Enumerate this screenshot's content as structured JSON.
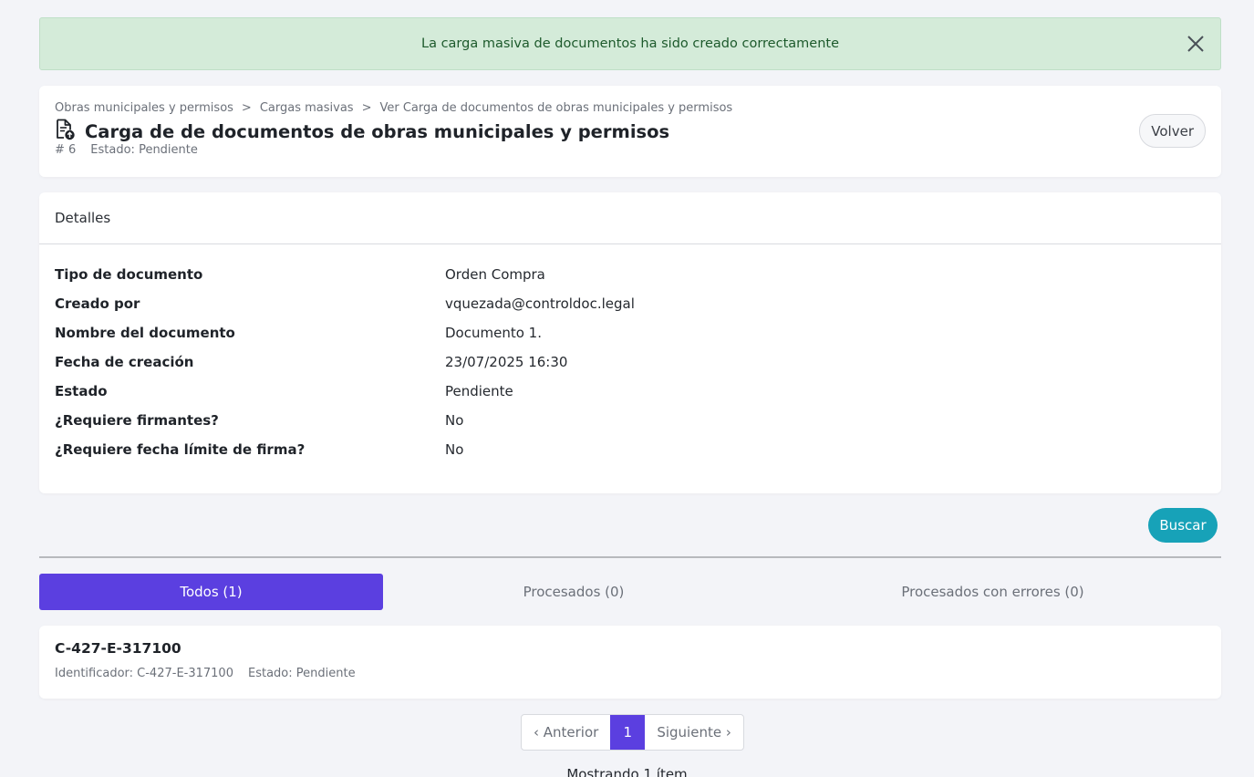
{
  "alert": {
    "message": "La carga masiva de documentos ha sido creado correctamente"
  },
  "header": {
    "breadcrumb": [
      "Obras municipales y permisos",
      ">",
      "Cargas masivas",
      ">",
      "Ver Carga de documentos de obras municipales y permisos"
    ],
    "title": "Carga de de documentos de obras municipales y permisos",
    "id_label": "# 6",
    "status_label": "Estado: Pendiente",
    "back_label": "Volver"
  },
  "details": {
    "heading": "Detalles",
    "rows": [
      {
        "label": "Tipo de documento",
        "value": "Orden Compra"
      },
      {
        "label": "Creado por",
        "value": "vquezada@controldoc.legal"
      },
      {
        "label": "Nombre del documento",
        "value": "Documento 1."
      },
      {
        "label": "Fecha de creación",
        "value": "23/07/2025 16:30"
      },
      {
        "label": "Estado",
        "value": "Pendiente"
      },
      {
        "label": "¿Requiere firmantes?",
        "value": "No"
      },
      {
        "label": "¿Requiere fecha límite de firma?",
        "value": "No"
      }
    ]
  },
  "search": {
    "label": "Buscar"
  },
  "tabs": [
    {
      "label": "Todos (1)",
      "active": true
    },
    {
      "label": "Procesados (0)",
      "active": false
    },
    {
      "label": "Procesados con errores (0)",
      "active": false
    }
  ],
  "items": [
    {
      "title": "C-427-E-317100",
      "identifier": "Identificador: C-427-E-317100",
      "status": "Estado: Pendiente"
    }
  ],
  "pagination": {
    "prev": "‹ Anterior",
    "current": "1",
    "next": "Siguiente ›"
  },
  "footer": {
    "showing": "Mostrando 1 ítem"
  },
  "colors": {
    "accent": "#5b3fe0",
    "search_button": "#17a2b8",
    "alert_bg": "#d4ebd9",
    "alert_text": "#1d5a2c"
  },
  "icons": {
    "alert_close": "close-icon",
    "title": "document-upload-icon"
  }
}
